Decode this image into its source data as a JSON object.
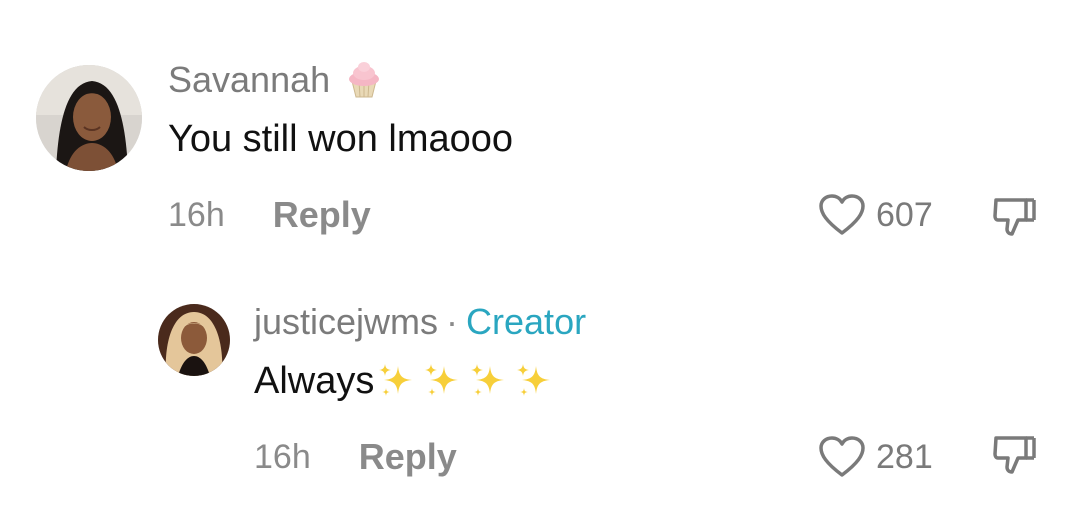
{
  "comments": [
    {
      "author": "Savannah",
      "author_emoji_icon": "cupcake-icon",
      "text": "You still won lmaooo",
      "time": "16h",
      "reply_label": "Reply",
      "likes": "607"
    }
  ],
  "replies": [
    {
      "author": "justicejwms",
      "separator": "·",
      "badge": "Creator",
      "text": "Always",
      "sparkles_icon": "sparkles-icon",
      "time": "16h",
      "reply_label": "Reply",
      "likes": "281"
    }
  ],
  "colors": {
    "creator_badge": "#2aa6c0",
    "meta_text": "#8a8a8a",
    "author_text": "#7b7b7b"
  }
}
